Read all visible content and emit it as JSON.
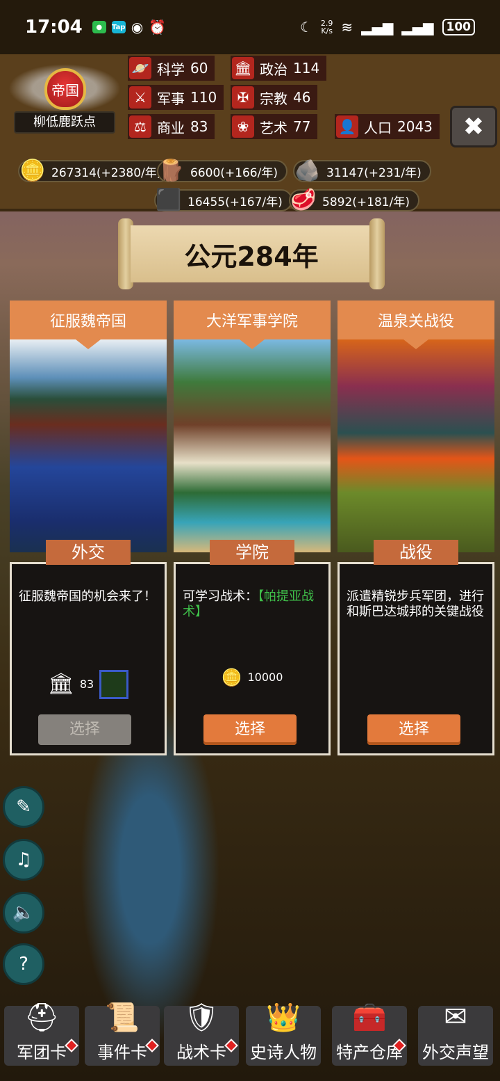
{
  "status_bar": {
    "time": "17:04",
    "app_icons": [
      "wechat-icon",
      "taptap-icon",
      "eye-icon",
      "alarm-icon"
    ],
    "taptap_text": "Tap",
    "net_speed_value": "2.9",
    "net_speed_unit": "K/s",
    "battery": "100"
  },
  "empire": {
    "title": "帝国",
    "name": "柳低鹿跃点"
  },
  "stats": [
    {
      "label": "科学",
      "value": "60",
      "icon": "planet-icon"
    },
    {
      "label": "政治",
      "value": "114",
      "icon": "pillar-building-icon"
    },
    {
      "label": "军事",
      "value": "110",
      "icon": "crossed-swords-icon"
    },
    {
      "label": "宗教",
      "value": "46",
      "icon": "cross-icon"
    },
    {
      "label": "商业",
      "value": "83",
      "icon": "scales-icon"
    },
    {
      "label": "艺术",
      "value": "77",
      "icon": "lotus-icon"
    },
    {
      "label": "人口",
      "value": "2043",
      "icon": "person-icon"
    }
  ],
  "resources": [
    {
      "text": "267314(+2380/年)",
      "icon": "gold-coins-icon"
    },
    {
      "text": "6600(+166/年)",
      "icon": "wood-logs-icon"
    },
    {
      "text": "31147(+231/年)",
      "icon": "stone-icon"
    },
    {
      "text": "16455(+167/年)",
      "icon": "iron-ingot-icon"
    },
    {
      "text": "5892(+181/年)",
      "icon": "meat-icon"
    }
  ],
  "year": "公元284年",
  "cards": [
    {
      "title": "征服魏帝国",
      "tag": "外交",
      "desc": "征服魏帝国的机会来了！",
      "cost_value": "83",
      "cost_icon": "pillar-building-icon",
      "select_label": "选择",
      "select_enabled": false
    },
    {
      "title": "大洋军事学院",
      "tag": "学院",
      "desc_prefix": "可学习战术：",
      "desc_highlight": "【帕提亚战术】",
      "cost_value": "10000",
      "cost_icon": "gold-coins-icon",
      "select_label": "选择",
      "select_enabled": true
    },
    {
      "title": "温泉关战役",
      "tag": "战役",
      "desc": "派遣精锐步兵军团，进行和斯巴达城邦的关键战役",
      "select_label": "选择",
      "select_enabled": true
    }
  ],
  "side_buttons": [
    "scroll-quill-icon",
    "music-off-icon",
    "speaker-icon",
    "help-icon"
  ],
  "bottom_nav": [
    {
      "label": "军团卡",
      "icon": "helmet-icon",
      "badge": true
    },
    {
      "label": "事件卡",
      "icon": "scroll-icon",
      "badge": true
    },
    {
      "label": "战术卡",
      "icon": "shield-swords-icon",
      "badge": true
    },
    {
      "label": "史诗人物",
      "icon": "crown-icon",
      "badge": false
    },
    {
      "label": "特产仓库",
      "icon": "treasure-chest-icon",
      "badge": true
    },
    {
      "label": "外交声望",
      "icon": "envelope-icon",
      "badge": false
    }
  ],
  "colors": {
    "accent_orange": "#e38a4e",
    "stat_red": "#b3261e",
    "highlight_green": "#3fbf4a"
  }
}
